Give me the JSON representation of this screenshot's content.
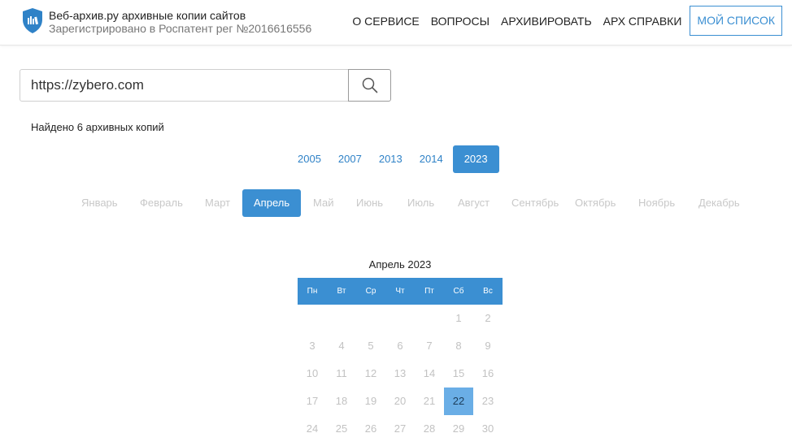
{
  "header": {
    "brand_title": "Веб-архив.ру архивные копии сайтов",
    "brand_subtitle": "Зарегистрировано в Роспатент рег №2016616556",
    "nav": [
      "О СЕРВИСЕ",
      "ВОПРОСЫ",
      "АРХИВИРОВАТЬ",
      "АРХ СПРАВКИ"
    ],
    "my_list": "МОЙ СПИСОК"
  },
  "search": {
    "value": "https://zybero.com",
    "icon": "search-icon"
  },
  "found_text": "Найдено 6 архивных копий",
  "years": [
    "2005",
    "2007",
    "2013",
    "2014",
    "2023"
  ],
  "active_year": "2023",
  "months": [
    "Январь",
    "Февраль",
    "Март",
    "Апрель",
    "Май",
    "Июнь",
    "Июль",
    "Август",
    "Сентябрь",
    "Октябрь",
    "Ноябрь",
    "Декабрь"
  ],
  "active_month": "Апрель",
  "calendar": {
    "title": "Апрель 2023",
    "weekdays": [
      "Пн",
      "Вт",
      "Ср",
      "Чт",
      "Пт",
      "Сб",
      "Вс"
    ],
    "weeks": [
      [
        "",
        "",
        "",
        "",
        "",
        "1",
        "2"
      ],
      [
        "3",
        "4",
        "5",
        "6",
        "7",
        "8",
        "9"
      ],
      [
        "10",
        "11",
        "12",
        "13",
        "14",
        "15",
        "16"
      ],
      [
        "17",
        "18",
        "19",
        "20",
        "21",
        "22",
        "23"
      ],
      [
        "24",
        "25",
        "26",
        "27",
        "28",
        "29",
        "30"
      ]
    ],
    "highlighted_day": "22"
  },
  "colors": {
    "accent": "#3b8fd2",
    "highlight": "#6aaee6",
    "muted": "#c8c8c8"
  }
}
